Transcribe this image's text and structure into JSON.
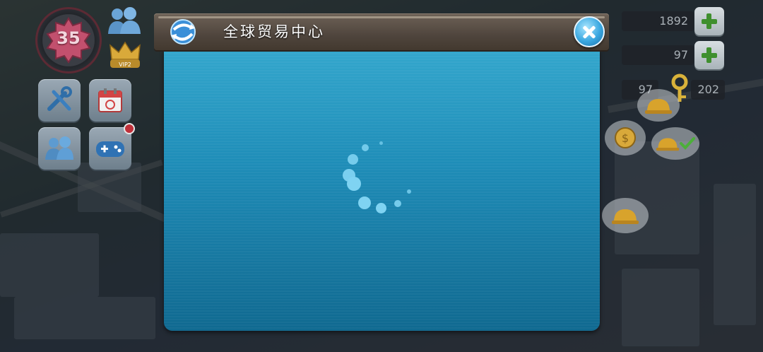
{
  "hud": {
    "level": "35",
    "resource_1": "1892",
    "resource_2": "97",
    "resource_3": "97",
    "resource_4": "202",
    "vip_label": "VIP2",
    "icons": [
      "friends-icon",
      "vip-crown-icon",
      "tools-icon",
      "calendar-icon",
      "neighbors-icon",
      "gamepad-icon",
      "plus-icon",
      "key-icon",
      "helmet-icon",
      "coin-icon",
      "checkmark-icon"
    ]
  },
  "dialog": {
    "title": "全球贸易中心",
    "state": "loading"
  },
  "colors": {
    "panel": "#1e8db8",
    "header": "#4f453d",
    "close_button": "#3aa7e0",
    "spinner": "#7fd3f2"
  }
}
